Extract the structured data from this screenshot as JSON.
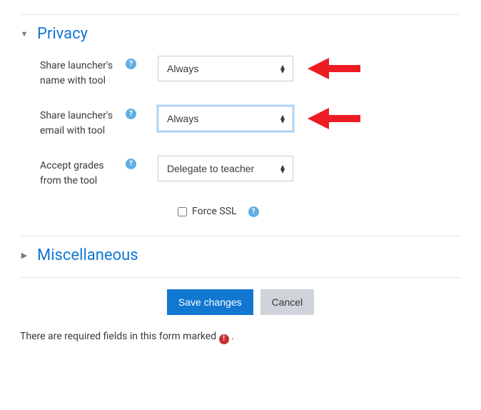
{
  "privacy": {
    "title": "Privacy",
    "fields": {
      "shareName": {
        "label": "Share launcher's name with tool",
        "value": "Always"
      },
      "shareEmail": {
        "label": "Share launcher's email with tool",
        "value": "Always"
      },
      "acceptGrades": {
        "label": "Accept grades from the tool",
        "value": "Delegate to teacher"
      },
      "forceSsl": {
        "label": "Force SSL",
        "checked": false
      }
    }
  },
  "misc": {
    "title": "Miscellaneous"
  },
  "buttons": {
    "save": "Save changes",
    "cancel": "Cancel"
  },
  "footer": {
    "text": "There are required fields in this form marked",
    "tail": "."
  }
}
